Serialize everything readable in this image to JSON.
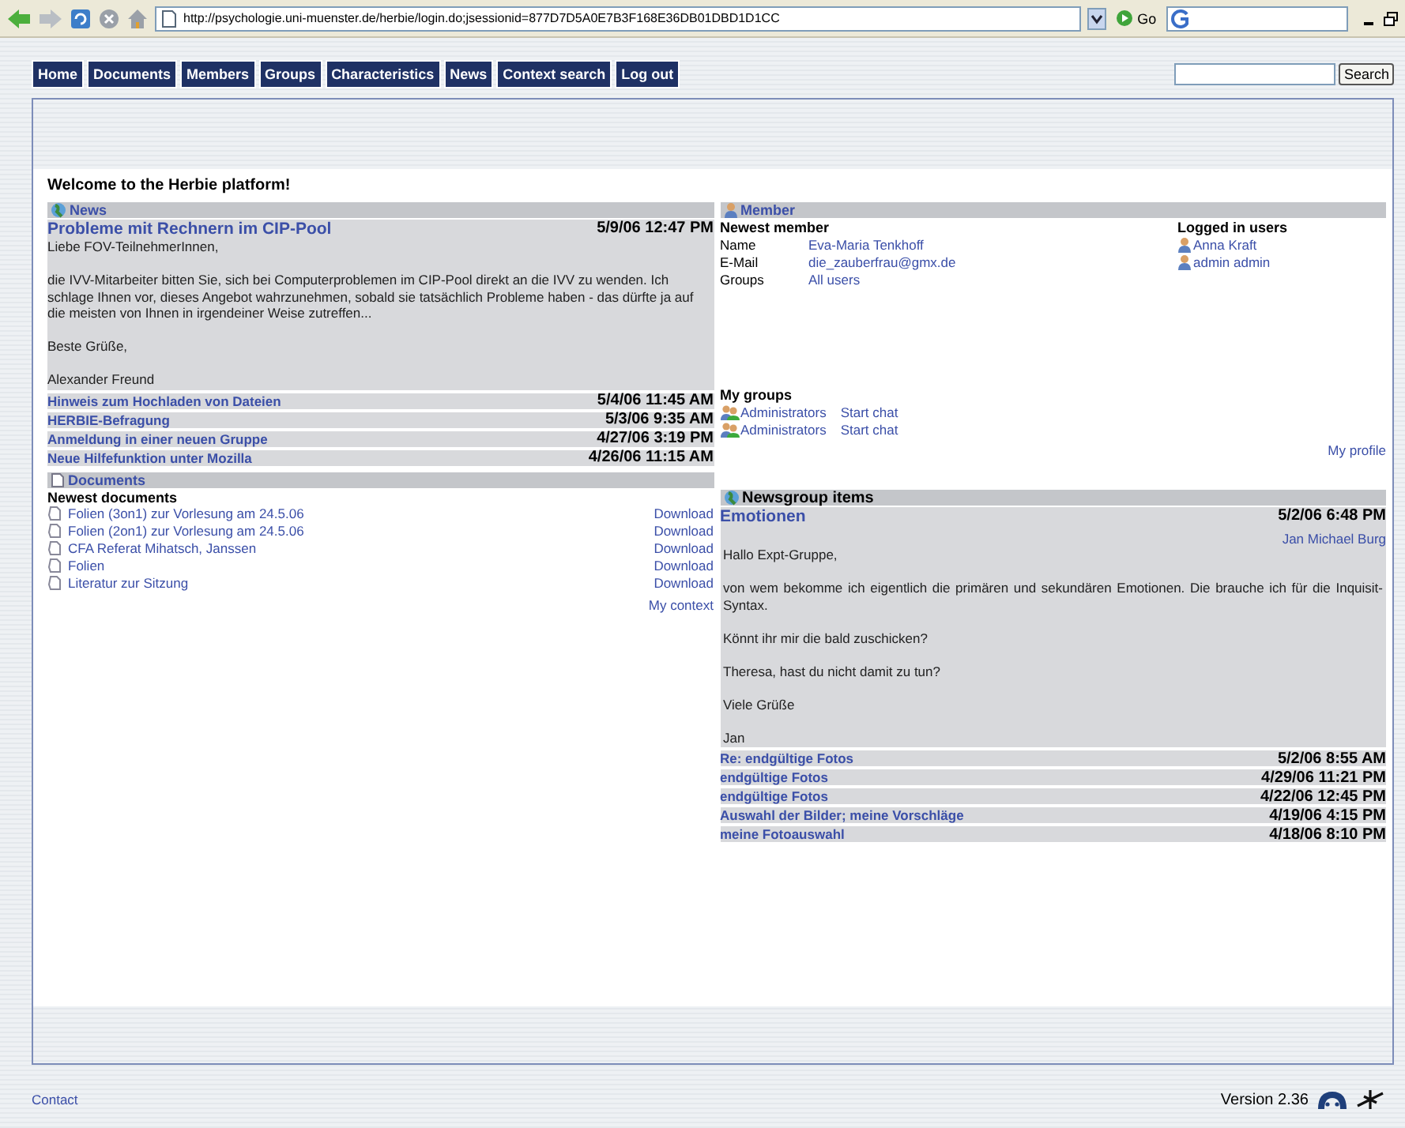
{
  "browser": {
    "url": "http://psychologie.uni-muenster.de/herbie/login.do;jsessionid=877D7D5A0E7B3F168E36DB01DBD1D1CC",
    "go_label": "Go"
  },
  "nav": {
    "items": [
      "Home",
      "Documents",
      "Members",
      "Groups",
      "Characteristics",
      "News",
      "Context search",
      "Log out"
    ],
    "search_button": "Search"
  },
  "welcome": "Welcome to the Herbie platform!",
  "news": {
    "title": "News",
    "featured": {
      "title": "Probleme mit Rechnern im CIP-Pool",
      "date": "5/9/06 12:47 PM",
      "paragraphs": [
        "Liebe FOV-TeilnehmerInnen,",
        "die IVV-Mitarbeiter bitten Sie, sich bei Computerproblemen im CIP-Pool direkt an die IVV zu wenden. Ich schlage Ihnen vor, dieses Angebot wahrzunehmen, sobald sie tatsächlich Probleme haben - das dürfte ja auf die meisten von Ihnen in irgendeiner Weise zutreffen...",
        "Beste Grüße,",
        "Alexander Freund"
      ]
    },
    "items": [
      {
        "title": "Hinweis zum Hochladen von Dateien",
        "date": "5/4/06 11:45 AM"
      },
      {
        "title": "HERBIE-Befragung",
        "date": "5/3/06 9:35 AM"
      },
      {
        "title": "Anmeldung in einer neuen Gruppe",
        "date": "4/27/06 3:19 PM"
      },
      {
        "title": "Neue Hilfefunktion unter Mozilla",
        "date": "4/26/06 11:15 AM"
      }
    ]
  },
  "member": {
    "title": "Member",
    "newest_heading": "Newest member",
    "fields": [
      {
        "label": "Name",
        "value": "Eva-Maria Tenkhoff"
      },
      {
        "label": "E-Mail",
        "value": "die_zauberfrau@gmx.de"
      },
      {
        "label": "Groups",
        "value": "All users"
      }
    ],
    "logged_in_heading": "Logged in users",
    "logged_in": [
      "Anna Kraft",
      "admin admin"
    ],
    "groups_heading": "My groups",
    "groups": [
      {
        "name": "Administrators",
        "action": "Start chat"
      },
      {
        "name": "Administrators",
        "action": "Start chat"
      }
    ],
    "profile_link": "My profile"
  },
  "documents": {
    "title": "Documents",
    "heading": "Newest documents",
    "items": [
      {
        "title": "Folien (3on1) zur Vorlesung am 24.5.06",
        "action": "Download"
      },
      {
        "title": "Folien (2on1) zur Vorlesung am 24.5.06",
        "action": "Download"
      },
      {
        "title": "CFA Referat Mihatsch, Janssen",
        "action": "Download"
      },
      {
        "title": "Folien",
        "action": "Download"
      },
      {
        "title": "Literatur zur Sitzung",
        "action": "Download"
      }
    ],
    "context_link": "My context"
  },
  "newsgroup": {
    "title": "Newsgroup items",
    "featured": {
      "title": "Emotionen",
      "date": "5/2/06 6:48 PM",
      "author": "Jan Michael Burg",
      "paragraphs": [
        "Hallo Expt-Gruppe,",
        "von wem bekomme ich eigentlich die primären und sekundären Emotionen. Die brauche ich für die Inquisit-Syntax.",
        "Könnt ihr mir die bald zuschicken?",
        "Theresa, hast du nicht damit zu tun?",
        "Viele Grüße",
        "Jan"
      ]
    },
    "items": [
      {
        "title": "Re: endgültige Fotos",
        "date": "5/2/06 8:55 AM"
      },
      {
        "title": "endgültige Fotos",
        "date": "4/29/06 11:21 PM"
      },
      {
        "title": "endgültige Fotos",
        "date": "4/22/06 12:45 PM"
      },
      {
        "title": "Auswahl der Bilder; meine Vorschläge",
        "date": "4/19/06 4:15 PM"
      },
      {
        "title": "meine Fotoauswahl",
        "date": "4/18/06 8:10 PM"
      }
    ]
  },
  "footer": {
    "contact": "Contact",
    "version": "Version 2.36"
  }
}
